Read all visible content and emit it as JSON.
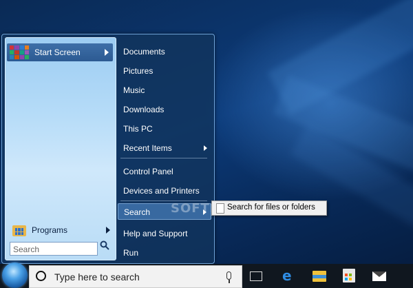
{
  "start_menu": {
    "start_screen_label": "Start Screen",
    "programs_label": "Programs",
    "search_placeholder": "Search",
    "right_items": [
      {
        "label": "Documents"
      },
      {
        "label": "Pictures"
      },
      {
        "label": "Music"
      },
      {
        "label": "Downloads"
      },
      {
        "label": "This PC"
      },
      {
        "label": "Recent Items"
      },
      {
        "label": "Control Panel"
      },
      {
        "label": "Devices and Printers"
      },
      {
        "label": "Search"
      },
      {
        "label": "Help and Support"
      },
      {
        "label": "Run"
      }
    ]
  },
  "submenu": {
    "search_files_label": "Search for files or folders"
  },
  "watermark": "SOFTPEDIA",
  "taskbar": {
    "search_placeholder": "Type here to search",
    "icons": [
      "start-orb-icon",
      "cortana-icon",
      "microphone-icon",
      "task-view-icon",
      "edge-icon",
      "file-explorer-icon",
      "store-icon",
      "mail-icon"
    ]
  },
  "colors": {
    "accent": "#2c5a92",
    "desktop": "#0c3b7a",
    "taskbar": "#10171f"
  }
}
